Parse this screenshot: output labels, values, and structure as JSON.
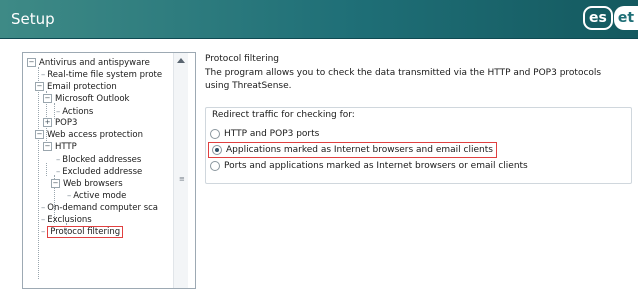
{
  "window": {
    "title": "Setup",
    "logo_boxed": "es",
    "logo_tail": "et"
  },
  "tree": {
    "items": [
      {
        "label": "Antivirus and antispyware",
        "expander": "−"
      },
      {
        "label": "Real-time file system prote"
      },
      {
        "label": "Email protection",
        "expander": "−"
      },
      {
        "label": "Microsoft Outlook",
        "expander": "−"
      },
      {
        "label": "Actions"
      },
      {
        "label": "POP3",
        "expander": "+"
      },
      {
        "label": "Web access protection",
        "expander": "−"
      },
      {
        "label": "HTTP",
        "expander": "−"
      },
      {
        "label": "Blocked addresses"
      },
      {
        "label": "Excluded addresse"
      },
      {
        "label": "Web browsers",
        "expander": "−"
      },
      {
        "label": "Active mode"
      },
      {
        "label": "On-demand computer sca"
      },
      {
        "label": "Exclusions"
      },
      {
        "label": "Protocol filtering",
        "selected": true
      }
    ],
    "scroll_up_icon": "scroll-up-arrow",
    "scroll_grip": "≡"
  },
  "content": {
    "section_title": "Protocol filtering",
    "description": "The program allows you to check the data transmitted via the HTTP and POP3 protocols using ThreatSense.",
    "group_label": "Redirect traffic for checking for:",
    "options": [
      {
        "label": "HTTP and POP3 ports",
        "checked": false
      },
      {
        "label": "Applications marked as Internet browsers and email clients",
        "checked": true,
        "highlighted": true
      },
      {
        "label": "Ports and applications marked as Internet browsers or email clients",
        "checked": false
      }
    ]
  },
  "colors": {
    "titlebar_start": "#3e8a86",
    "titlebar_end": "#14595f",
    "highlight": "#e04040"
  }
}
